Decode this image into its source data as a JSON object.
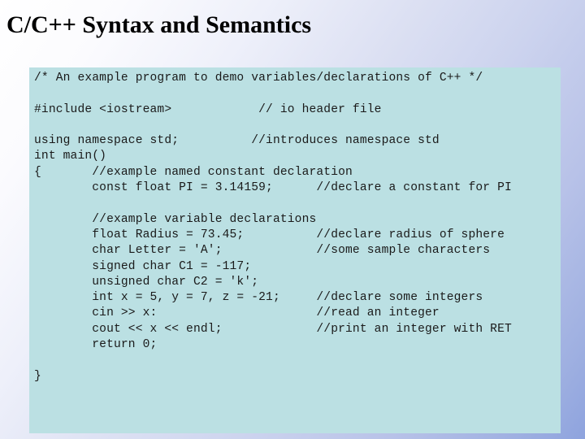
{
  "slide": {
    "title": "C/C++ Syntax and Semantics",
    "colors": {
      "panel_background": "#bbe0e3",
      "code_text": "#1a1a1a",
      "title_text": "#000000",
      "background_start": "#ffffff",
      "background_end": "#8ea3de"
    }
  },
  "code_panel": {
    "language": "C++",
    "lines": [
      "/* An example program to demo variables/declarations of C++ */",
      "",
      "#include <iostream>            // io header file",
      "",
      "using namespace std;          //introduces namespace std",
      "int main()",
      "{       //example named constant declaration",
      "        const float PI = 3.14159;      //declare a constant for PI",
      "",
      "        //example variable declarations",
      "        float Radius = 73.45;          //declare radius of sphere",
      "        char Letter = 'A';             //some sample characters",
      "        signed char C1 = -117;",
      "        unsigned char C2 = 'k';",
      "        int x = 5, y = 7, z = -21;     //declare some integers",
      "        cin >> x:                      //read an integer",
      "        cout << x << endl;             //print an integer with RET",
      "        return 0;",
      "",
      "}"
    ]
  }
}
